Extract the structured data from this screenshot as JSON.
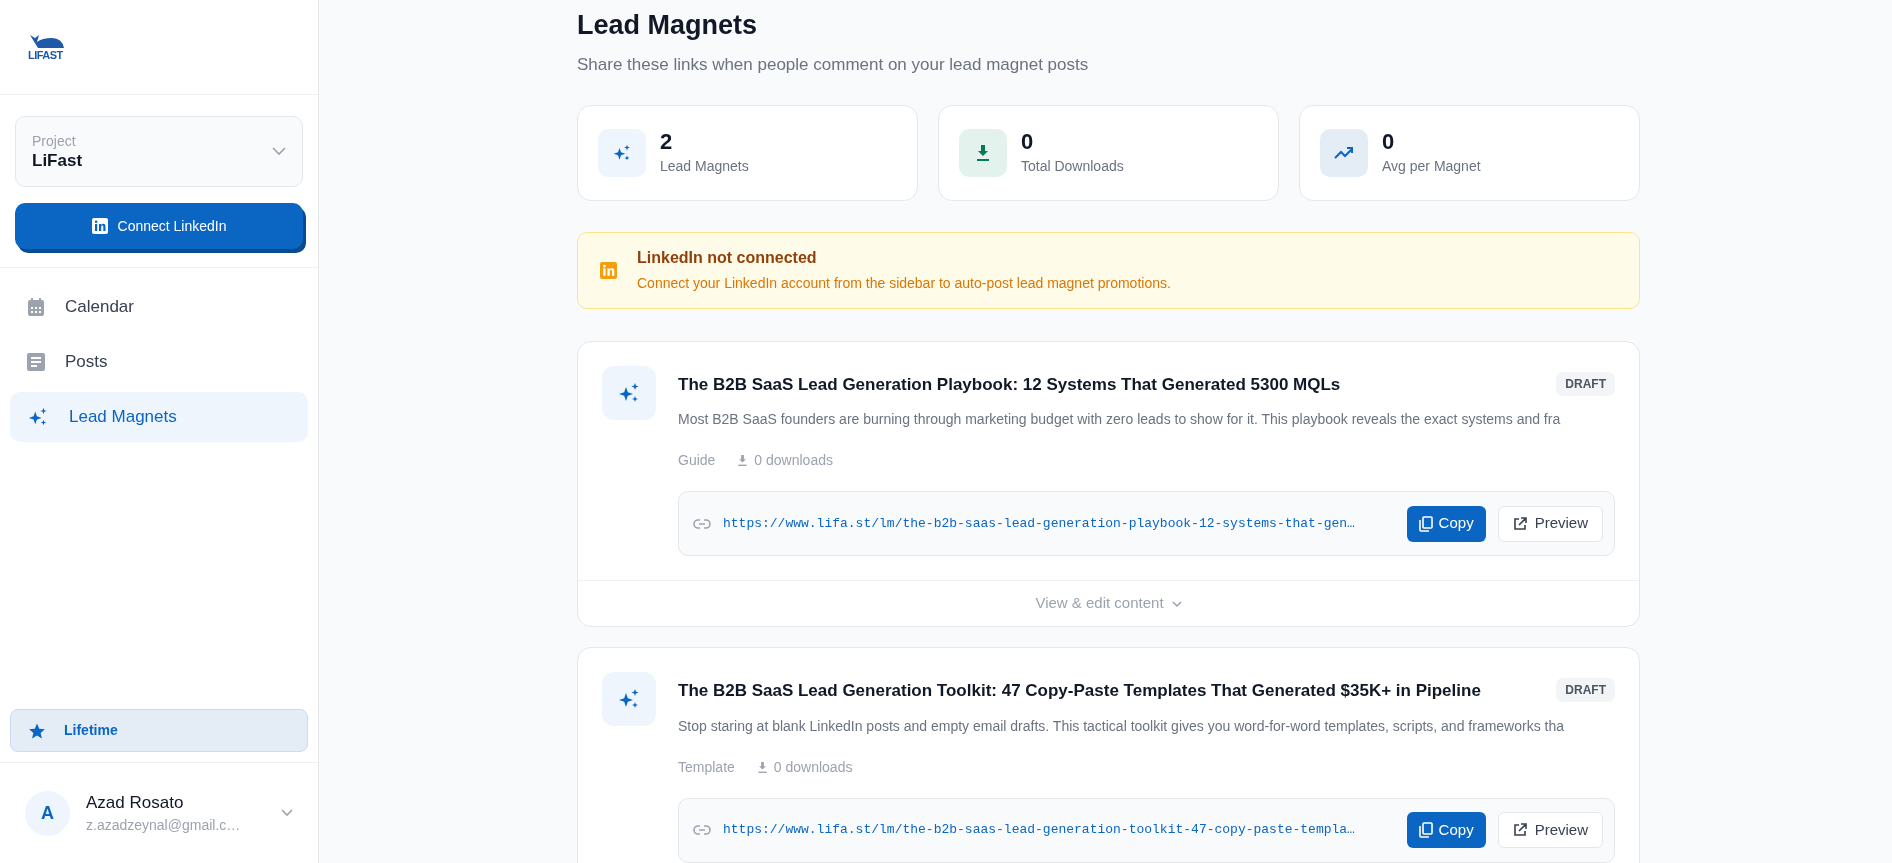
{
  "sidebar": {
    "logo_text": "LIFAST",
    "project": {
      "label": "Project",
      "value": "LiFast"
    },
    "connect_button": "Connect LinkedIn",
    "nav": [
      {
        "label": "Calendar",
        "kind": "calendar",
        "selected": false
      },
      {
        "label": "Posts",
        "kind": "posts",
        "selected": false
      },
      {
        "label": "Lead Magnets",
        "kind": "sparkles",
        "selected": true
      }
    ],
    "plan": "Lifetime",
    "user": {
      "initial": "A",
      "name": "Azad Rosato",
      "email": "z.azadzeynal@gmail.c…"
    }
  },
  "header": {
    "title": "Lead Magnets",
    "subtitle": "Share these links when people comment on your lead magnet posts"
  },
  "stats": [
    {
      "kind": "sparkles",
      "value": "2",
      "label": "Lead Magnets"
    },
    {
      "kind": "download",
      "value": "0",
      "label": "Total Downloads"
    },
    {
      "kind": "trend",
      "value": "0",
      "label": "Avg per Magnet"
    }
  ],
  "alert": {
    "title": "LinkedIn not connected",
    "message": "Connect your LinkedIn account from the sidebar to auto-post lead magnet promotions."
  },
  "magnets": [
    {
      "title": "The B2B SaaS Lead Generation Playbook: 12 Systems That Generated 5300 MQLs",
      "status": "DRAFT",
      "description": "Most B2B SaaS founders are burning through marketing budget with zero leads to show for it. This playbook reveals the exact systems and fra",
      "type": "Guide",
      "downloads": "0 downloads",
      "url": "https://www.lifa.st/lm/the-b2b-saas-lead-generation-playbook-12-systems-that-gen…",
      "copy": "Copy",
      "preview": "Preview",
      "footer": "View & edit content"
    },
    {
      "title": "The B2B SaaS Lead Generation Toolkit: 47 Copy-Paste Templates That Generated $35K+ in Pipeline",
      "status": "DRAFT",
      "description": "Stop staring at blank LinkedIn posts and empty email drafts. This tactical toolkit gives you word-for-word templates, scripts, and frameworks tha",
      "type": "Template",
      "downloads": "0 downloads",
      "url": "https://www.lifa.st/lm/the-b2b-saas-lead-generation-toolkit-47-copy-paste-templa…",
      "copy": "Copy",
      "preview": "Preview"
    }
  ]
}
